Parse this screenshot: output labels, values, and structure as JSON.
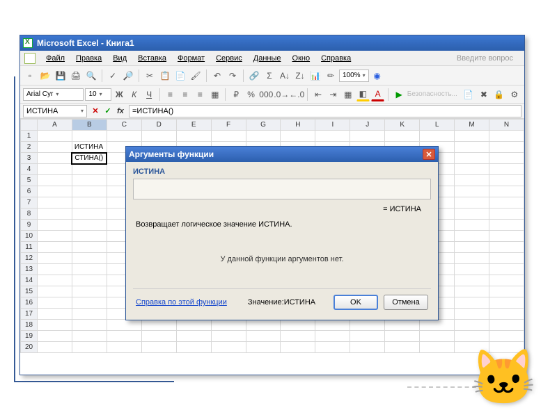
{
  "window": {
    "title": "Microsoft Excel - Книга1"
  },
  "menu": {
    "items": [
      "Файл",
      "Правка",
      "Вид",
      "Вставка",
      "Формат",
      "Сервис",
      "Данные",
      "Окно",
      "Справка"
    ],
    "ask_hint": "Введите вопрос"
  },
  "toolbar": {
    "zoom": "100%"
  },
  "format_bar": {
    "font": "Arial Cyr",
    "size": "10",
    "security_label": "Безопасность..."
  },
  "formula_bar": {
    "name_box": "ИСТИНА",
    "formula": "=ИСТИНА()"
  },
  "grid": {
    "columns": [
      "A",
      "B",
      "C",
      "D",
      "E",
      "F",
      "G",
      "H",
      "I",
      "J",
      "K",
      "L",
      "M",
      "N"
    ],
    "rows": 20,
    "cells": {
      "B2": "ИСТИНА",
      "B3": "СТИНА()"
    },
    "active": "B3",
    "selected_col": "B"
  },
  "dialog": {
    "title": "Аргументы функции",
    "func_name": "ИСТИНА",
    "result_prefix": "=",
    "result_value": "ИСТИНА",
    "description": "Возвращает логическое значение ИСТИНА.",
    "no_args_msg": "У данной функции аргументов нет.",
    "help_link": "Справка по этой функции",
    "value_label": "Значение:",
    "value_text": "ИСТИНА",
    "ok": "OK",
    "cancel": "Отмена"
  }
}
